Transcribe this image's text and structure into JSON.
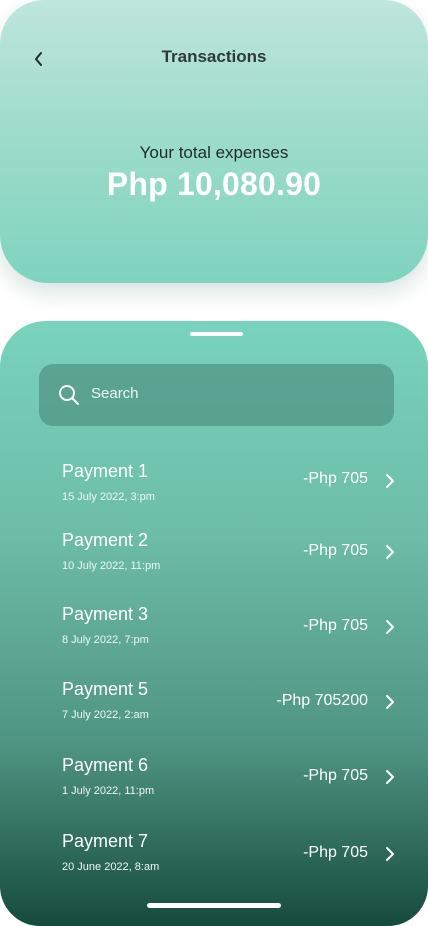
{
  "header": {
    "title": "Transactions",
    "expenses_label": "Your total expenses",
    "expenses_total": "Php 10,080.90"
  },
  "search": {
    "placeholder": "Search"
  },
  "transactions": [
    {
      "name": "Payment 1",
      "date": "15 July 2022, 3:pm",
      "amount": "-Php 705"
    },
    {
      "name": "Payment 2",
      "date": "10 July 2022, 11:pm",
      "amount": "-Php 705"
    },
    {
      "name": "Payment 3",
      "date": "8 July 2022, 7:pm",
      "amount": "-Php 705"
    },
    {
      "name": "Payment 5",
      "date": "7 July 2022, 2:am",
      "amount": "-Php 705200"
    },
    {
      "name": "Payment 6",
      "date": "1 July 2022, 11:pm",
      "amount": "-Php 705"
    },
    {
      "name": "Payment 7",
      "date": "20 June 2022, 8:am",
      "amount": "-Php 705"
    }
  ],
  "icons": {
    "back": "chevron-left-icon",
    "search": "search-icon",
    "row_chevron": "chevron-right-icon"
  },
  "colors": {
    "header_gradient_top": "#bfe6dc",
    "header_gradient_bottom": "#7fd3bf",
    "list_gradient_top": "#78d3bd",
    "list_gradient_bottom": "#164b3c",
    "title_text": "#2f3a3a"
  }
}
